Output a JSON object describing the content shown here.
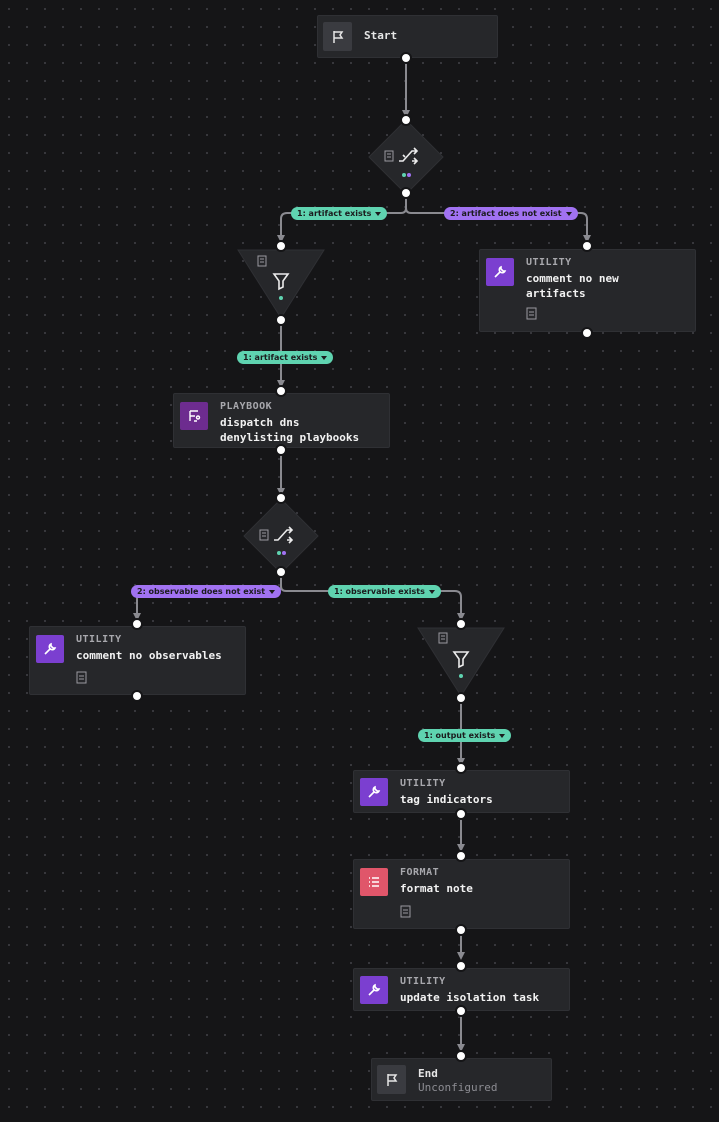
{
  "nodes": {
    "start": {
      "label": "Start",
      "icon": "flag-icon"
    },
    "decision_1": {
      "icon": "branch-icon"
    },
    "filter_1": {
      "icon": "filter-icon"
    },
    "utility_comment_artifacts": {
      "type": "UTILITY",
      "name_line1": "comment no new",
      "name_line2": "artifacts"
    },
    "playbook_dispatch": {
      "type": "PLAYBOOK",
      "name_line1": "dispatch dns",
      "name_line2": "denylisting playbooks"
    },
    "decision_2": {
      "icon": "branch-icon"
    },
    "utility_comment_observables": {
      "type": "UTILITY",
      "name": "comment no observables"
    },
    "filter_2": {
      "icon": "filter-icon"
    },
    "utility_tag": {
      "type": "UTILITY",
      "name": "tag indicators"
    },
    "format_note": {
      "type": "FORMAT",
      "name": "format note"
    },
    "utility_update": {
      "type": "UTILITY",
      "name": "update isolation task"
    },
    "end": {
      "label": "End",
      "sub": "Unconfigured"
    }
  },
  "badges": {
    "artifact_exists_1": "1: artifact exists",
    "artifact_not_exist": "2: artifact does not exist",
    "artifact_exists_2": "1: artifact exists",
    "observable_not_exist": "2: observable does not exist",
    "observable_exists": "1: observable exists",
    "output_exists": "1: output exists"
  },
  "colors": {
    "background": "#151517",
    "node": "#26272a",
    "wire": "#8a8a90",
    "utility": "#7b3fd0",
    "playbook": "#6d2c8f",
    "format": "#e0566a",
    "badge_green": "#5fd3b0",
    "badge_purple": "#a172f2"
  }
}
